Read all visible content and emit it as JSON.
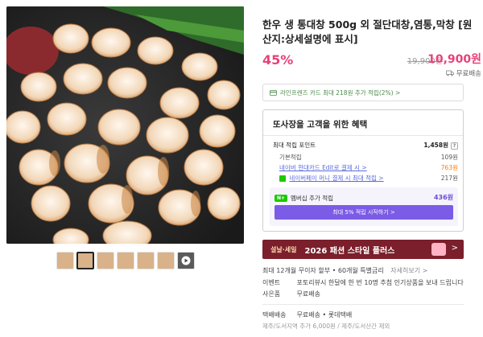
{
  "product": {
    "title": "한우 생 통대창 500g 외 절단대창,염통,막창 [원산지:상세설명에 표시]",
    "discount": "45%",
    "original_price": "19,900원",
    "price": "10,900원",
    "shipping": "무료배송"
  },
  "card_benefit": "라인프렌즈 카드 최대 218원 추가 적립(2%) >",
  "benefits": {
    "title": "또사장을 고객을 위한 혜택",
    "max_point_label": "최대 적립 포인트",
    "max_point_value": "1,458원",
    "qmark": "?",
    "rows": [
      {
        "label": "기본적립",
        "value": "109원"
      },
      {
        "label": "네이버 현대카드 Edit로 결제 시 >",
        "value": "763원"
      },
      {
        "label": "네이버페이 머니 결제 시 최대 적립 >",
        "value": "217원"
      }
    ],
    "membership_label": "멤버십 추가 적립",
    "membership_badge": "N+",
    "membership_value": "436원",
    "membership_cta": "최대 5% 적립 시작하기 >"
  },
  "banner": {
    "small": "설날·세일",
    "main": "2026 패션 스타일 플러스",
    "chevron": ">"
  },
  "info_lines": [
    {
      "key": "",
      "text": "최대 12개월 무이자 할부 • 60개월 특별금리",
      "more": "자세히보기 >"
    },
    {
      "key": "이벤트",
      "text": "포토리뷰시 한달에 한 번 10명 추첨 인기상품을 보내 드립니다",
      "more": ""
    },
    {
      "key": "사은품",
      "text": "무료배송",
      "more": ""
    }
  ],
  "delivery": {
    "key": "택배배송",
    "text": "무료배송 • 롯데택배",
    "sub": "제주/도서지역 추가 6,000원 / 제주/도서산간 제외"
  },
  "colors": {
    "accent": "#e8417a",
    "membership": "#7b5ce6",
    "banner": "#7a1f2b"
  }
}
